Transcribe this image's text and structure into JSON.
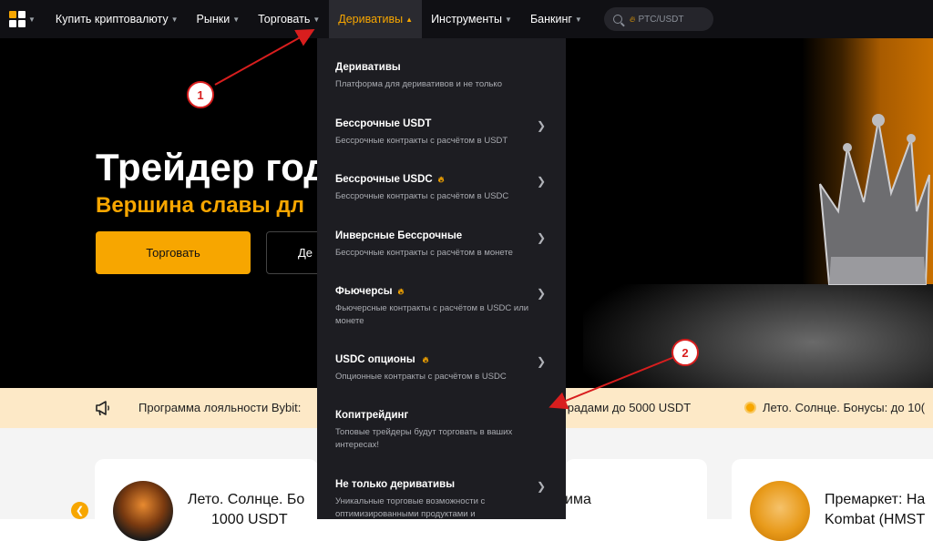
{
  "nav": {
    "items": [
      {
        "label": "Купить криптовалюту"
      },
      {
        "label": "Рынки"
      },
      {
        "label": "Торговать"
      },
      {
        "label": "Деривативы"
      },
      {
        "label": "Инструменты"
      },
      {
        "label": "Банкинг"
      }
    ],
    "search_placeholder": "PTC/USDT"
  },
  "hero": {
    "title": "Трейдер год",
    "subtitle": "Вершина славы дл",
    "trade_button": "Торговать",
    "demo_button": "Де"
  },
  "ticker": {
    "text1": "Программа лояльности Bybit:",
    "text2": "градами до 5000 USDT",
    "text3": "Лето. Солнце. Бонусы: до 10("
  },
  "cards": [
    {
      "title": "Лето. Солнце. Бо",
      "sub": "1000 USDT"
    },
    {
      "title": "има"
    },
    {
      "title": "Премаркет: На",
      "sub": "Kombat (HMST"
    }
  ],
  "menu": {
    "items": [
      {
        "title": "Деривативы",
        "desc": "Платформа для деривативов и не только",
        "fire": false,
        "chevron": false
      },
      {
        "title": "Бессрочные USDT",
        "desc": "Бессрочные контракты с расчётом в USDT",
        "fire": false,
        "chevron": true
      },
      {
        "title": "Бессрочные USDC",
        "desc": "Бессрочные контракты с расчётом в USDC",
        "fire": true,
        "chevron": true
      },
      {
        "title": "Инверсные Бессрочные",
        "desc": "Бессрочные контракты с расчётом в монете",
        "fire": false,
        "chevron": true
      },
      {
        "title": "Фьючерсы",
        "desc": "Фьючерсные контракты с расчётом в USDC или монете",
        "fire": true,
        "chevron": true
      },
      {
        "title": "USDC опционы",
        "desc": "Опционные контракты с расчётом в USDC",
        "fire": true,
        "chevron": true
      },
      {
        "title": "Копитрейдинг",
        "desc": "Топовые трейдеры будут торговать в ваших интересах!",
        "fire": false,
        "chevron": false
      },
      {
        "title": "Не только деривативы",
        "desc": "Уникальные торговые возможности с оптимизированными продуктами и",
        "fire": false,
        "chevron": true
      }
    ]
  },
  "annotations": {
    "callout1": "1",
    "callout2": "2"
  },
  "colors": {
    "accent": "#f7a600",
    "nav_bg": "#101014",
    "menu_bg": "#1d1d22",
    "ticker_bg": "#fde9c7",
    "callout_red": "#d81e1e"
  }
}
